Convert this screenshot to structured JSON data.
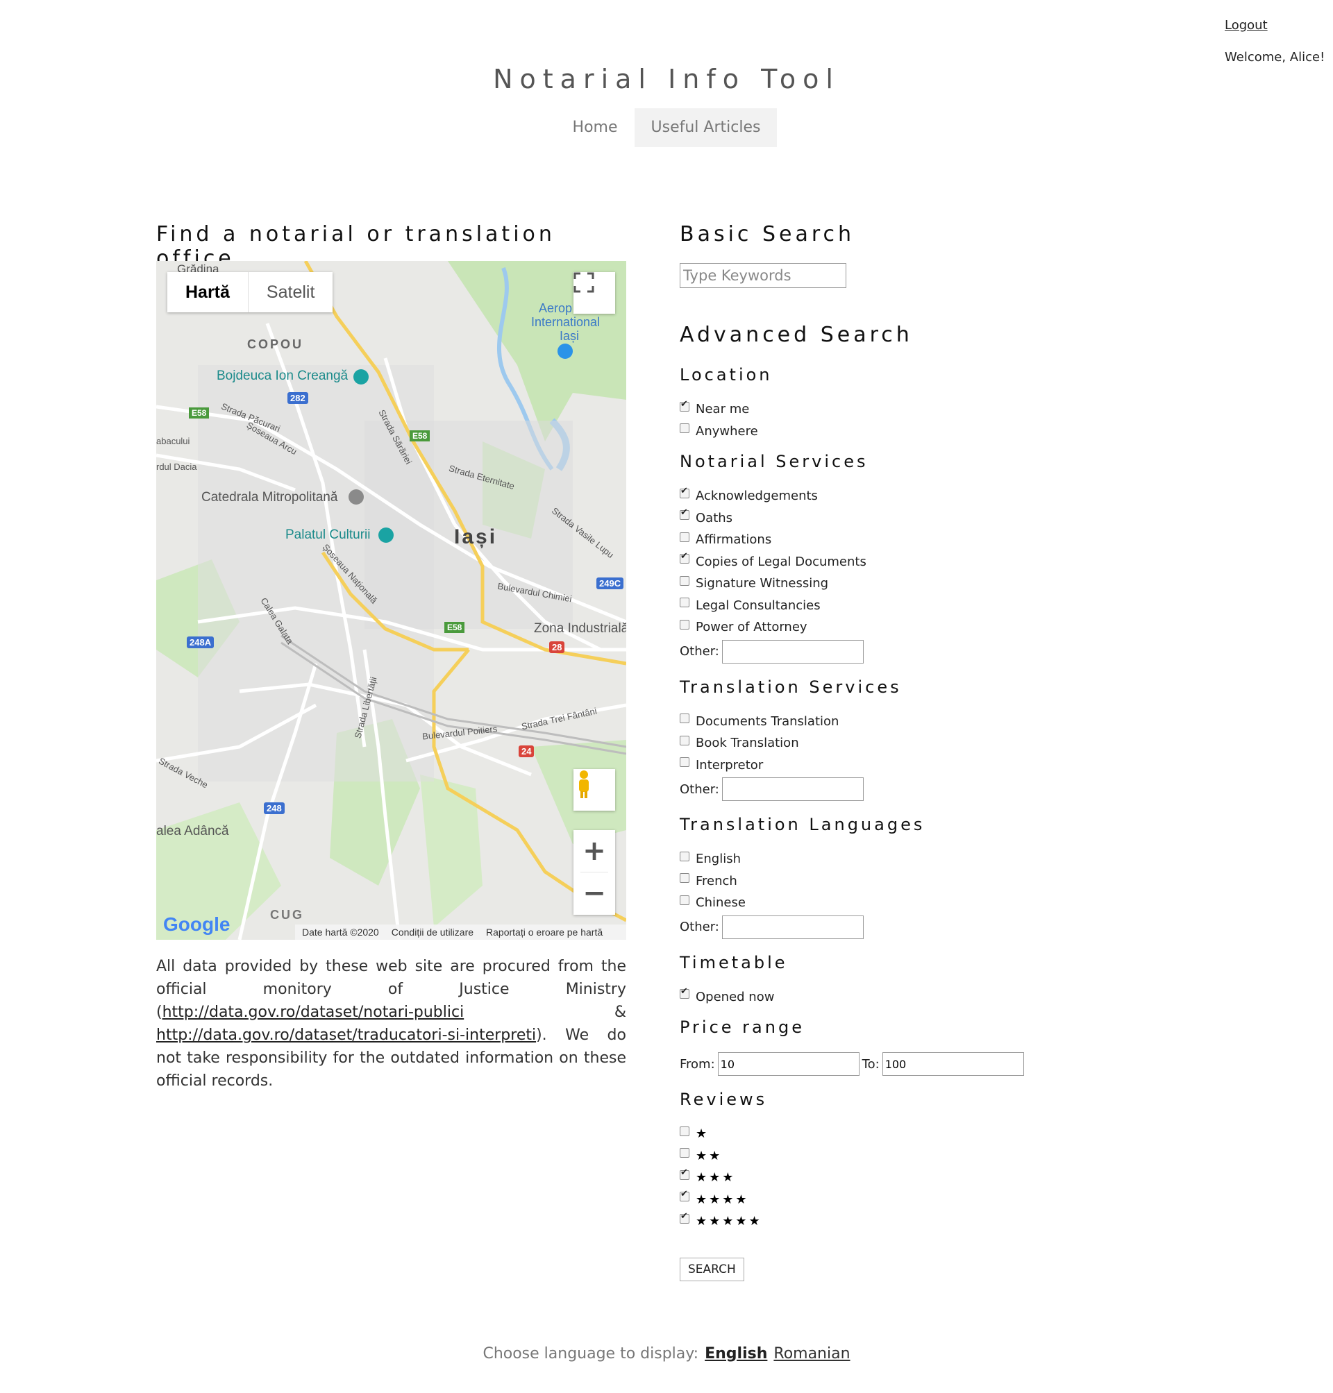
{
  "auth": {
    "logout_label": "Logout",
    "welcome_text": "Welcome, Alice!"
  },
  "header": {
    "title": "Notarial Info Tool"
  },
  "nav": {
    "items": [
      {
        "label": "Home"
      },
      {
        "label": "Useful Articles"
      }
    ]
  },
  "left": {
    "heading": "Find a notarial or translation office",
    "map": {
      "type_selected": "Hartă",
      "type_other": "Satelit",
      "google_text": "Google",
      "footer": [
        "Date hartă ©2020",
        "Condiții de utilizare",
        "Raportați o eroare pe hartă"
      ],
      "places": {
        "gradina": "Grădina",
        "copou": "COPOU",
        "aerop": "Aerop",
        "international": "International",
        "iasi_airport": "Iași",
        "bojdeuca": "Bojdeuca Ion Creangă",
        "catedrala": "Catedrala Mitropolitană",
        "palatul": "Palatul Culturii",
        "iasi": "Iași",
        "zona": "Zona Industrială",
        "valea": "alea Adâncă",
        "cug": "CUG",
        "bacului": "abacului",
        "dacia": "rdul Dacia",
        "str_pacurari": "Strada Păcurari",
        "sos_arcu": "Șoseaua Arcu",
        "str_sararie": "Strada Sărăriei",
        "str_eternitate": "Strada Eternitate",
        "str_vasile": "Strada Vasile Lupu",
        "bd_chimiei": "Bulevardul Chimiei",
        "sos_nationala": "Șoseaua Națională",
        "calea_galata": "Calea Galata",
        "str_libertatii": "Strada Libertății",
        "bd_poitiers": "Bulevardul Poitiers",
        "str_trei": "Strada Trei Fântâni",
        "str_veche": "Strada Veche"
      },
      "shields": [
        "E58",
        "E58",
        "282",
        "E58",
        "249C",
        "248A",
        "28",
        "24",
        "248"
      ]
    },
    "disclaimer": {
      "p1": "All data provided by these web site are procured from the official monitory of Justice Ministry (",
      "link1": "http://data.gov.ro/dataset/notari-publici",
      "amp": " & ",
      "link2": "http://data.gov.ro/dataset/traducatori-si-interpreti",
      "p2": "). We do not take responsibility for the outdated information on these official records."
    }
  },
  "basic_search": {
    "heading": "Basic Search",
    "placeholder": "Type Keywords"
  },
  "advanced_search": {
    "heading": "Advanced Search",
    "location": {
      "heading": "Location",
      "options": [
        {
          "label": "Near me",
          "checked": true
        },
        {
          "label": "Anywhere",
          "checked": false
        }
      ]
    },
    "notarial": {
      "heading": "Notarial Services",
      "options": [
        {
          "label": "Acknowledgements",
          "checked": true
        },
        {
          "label": "Oaths",
          "checked": true
        },
        {
          "label": "Affirmations",
          "checked": false
        },
        {
          "label": "Copies of Legal Documents",
          "checked": true
        },
        {
          "label": "Signature Witnessing",
          "checked": false
        },
        {
          "label": "Legal Consultancies",
          "checked": false
        },
        {
          "label": "Power of Attorney",
          "checked": false
        }
      ],
      "other_label": "Other:"
    },
    "translation": {
      "heading": "Translation Services",
      "options": [
        {
          "label": "Documents Translation",
          "checked": false
        },
        {
          "label": "Book Translation",
          "checked": false
        },
        {
          "label": "Interpretor",
          "checked": false
        }
      ],
      "other_label": "Other:"
    },
    "languages": {
      "heading": "Translation Languages",
      "options": [
        {
          "label": "English",
          "checked": false
        },
        {
          "label": "French",
          "checked": false
        },
        {
          "label": "Chinese",
          "checked": false
        }
      ],
      "other_label": "Other:"
    },
    "timetable": {
      "heading": "Timetable",
      "options": [
        {
          "label": "Opened now",
          "checked": true
        }
      ]
    },
    "price": {
      "heading": "Price range",
      "from_label": "From:",
      "from_value": "10",
      "to_label": "To:",
      "to_value": "100"
    },
    "reviews": {
      "heading": "Reviews",
      "options": [
        {
          "stars": "★",
          "checked": false
        },
        {
          "stars": "★★",
          "checked": false
        },
        {
          "stars": "★★★",
          "checked": true
        },
        {
          "stars": "★★★★",
          "checked": true
        },
        {
          "stars": "★★★★★",
          "checked": true
        }
      ]
    },
    "search_label": "SEARCH"
  },
  "footer": {
    "prefix": "Choose language to display:",
    "lang1": "English",
    "lang2": "Romanian"
  }
}
